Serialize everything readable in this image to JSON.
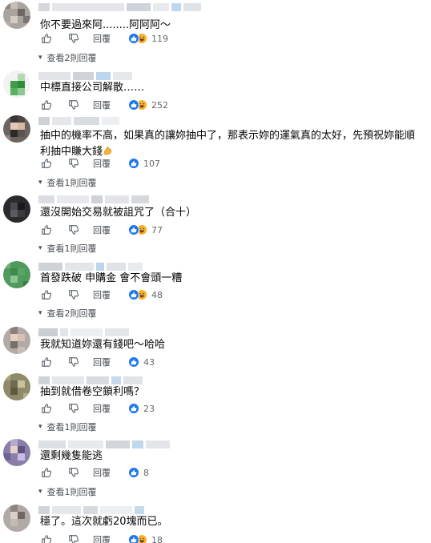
{
  "ui": {
    "reply_label": "回覆",
    "colors": {
      "accent": "#1877f2",
      "haha": "#f7b125",
      "muted": "#65676b"
    }
  },
  "comments": [
    {
      "text": "你不要過來阿........阿阿阿～",
      "reactions": [
        "like",
        "haha"
      ],
      "count": "119",
      "view_replies": "查看2則回覆"
    },
    {
      "text": "中標直接公司解散……",
      "reactions": [
        "like",
        "haha"
      ],
      "count": "252",
      "view_replies": ""
    },
    {
      "text": "抽中的機率不高，如果真的讓妳抽中了，那表示妳的運氣真的太好，先預祝妳能順利抽中賺大錢",
      "emoji": "muscle-emoji",
      "reactions": [
        "like"
      ],
      "count": "107",
      "view_replies": "查看1則回覆"
    },
    {
      "text": "還沒開始交易就被詛咒了（合十）",
      "reactions": [
        "like",
        "haha"
      ],
      "count": "77",
      "view_replies": "查看1則回覆"
    },
    {
      "text": "首發跌破 申購金 會不會頭一糟",
      "reactions": [
        "like",
        "haha"
      ],
      "count": "48",
      "view_replies": "查看2則回覆"
    },
    {
      "text": "我就知道妳還有錢吧～哈哈",
      "reactions": [
        "like"
      ],
      "count": "43",
      "view_replies": ""
    },
    {
      "text": "抽到就借卷空鎖利嗎？",
      "reactions": [
        "like"
      ],
      "count": "23",
      "view_replies": "查看1則回覆"
    },
    {
      "text": "還剩幾隻能逃",
      "reactions": [
        "like"
      ],
      "count": "8",
      "view_replies": "查看1則回覆"
    },
    {
      "text": "穩了。這次就虧20塊而已。",
      "reactions": [
        "like",
        "haha"
      ],
      "count": "18",
      "view_replies": ""
    }
  ]
}
